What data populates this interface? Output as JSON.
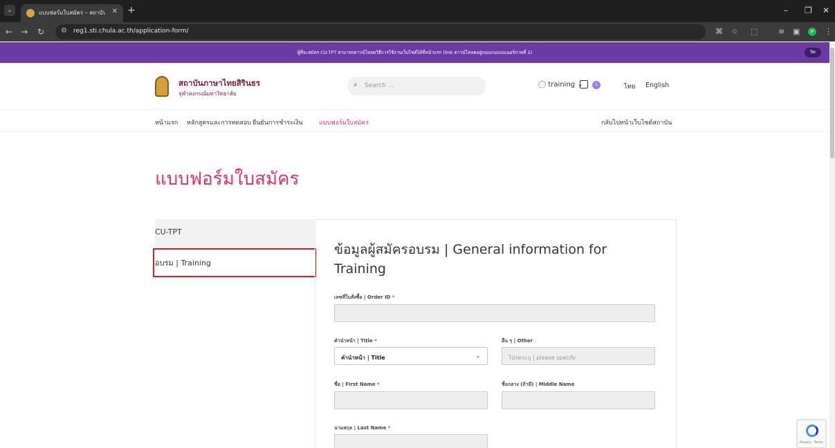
{
  "browser": {
    "tab_title": "แบบฟอร์มใบสมัคร – สถาบันภาษาไทย",
    "url": "reg1.sti.chula.ac.th/application-form/"
  },
  "announcement": {
    "text": "ผู้ที่จะสมัคร CU-TPT สามารถดาวน์โหลดวิธีการใช้งานเว็บไซต์ได้ที่หน้าแรก (link ดาวน์โหลดอยู่บนแถบแบนเนอร์ภาพที่ 2)",
    "close_label": "ปิด"
  },
  "header": {
    "logo_title": "สถาบันภาษาไทยสิรินธร",
    "logo_subtitle": "จุฬาลงกรณ์มหาวิทยาลัย",
    "search_placeholder": "Search ...",
    "user_label": "training",
    "cart_count": "1",
    "lang_thai": "ไทย",
    "lang_english": "English"
  },
  "nav": {
    "items": [
      "หน้าแรก",
      "หลักสูตรและการทดสอบ",
      "ยืนยันการชำระเงิน",
      "แบบฟอร์มใบสมัคร"
    ],
    "back_link": "กลับไปหน้าเว็บไซต์สถาบัน"
  },
  "page_title": "แบบฟอร์มใบสมัคร",
  "side_tabs": [
    "CU-TPT",
    "อบรม | Training"
  ],
  "form": {
    "heading": "ข้อมูลผู้สมัครอบรม | General information for Training",
    "order_id_label": "เลขที่ใบสั่งซื้อ | Order ID",
    "title_label": "คำนำหน้า | Title",
    "title_value": "คำนำหน้า | Title",
    "other_label": "อื่น ๆ | Other",
    "other_placeholder": "โปรดระบุ | please specify",
    "first_name_label": "ชื่อ | First Name",
    "middle_name_label": "ชื่อกลาง (ถ้ามี) | Middle Name",
    "last_name_label": "นามสกุล | Last Name",
    "required_mark": "*"
  },
  "recaptcha": {
    "text": "Privacy - Terms"
  }
}
